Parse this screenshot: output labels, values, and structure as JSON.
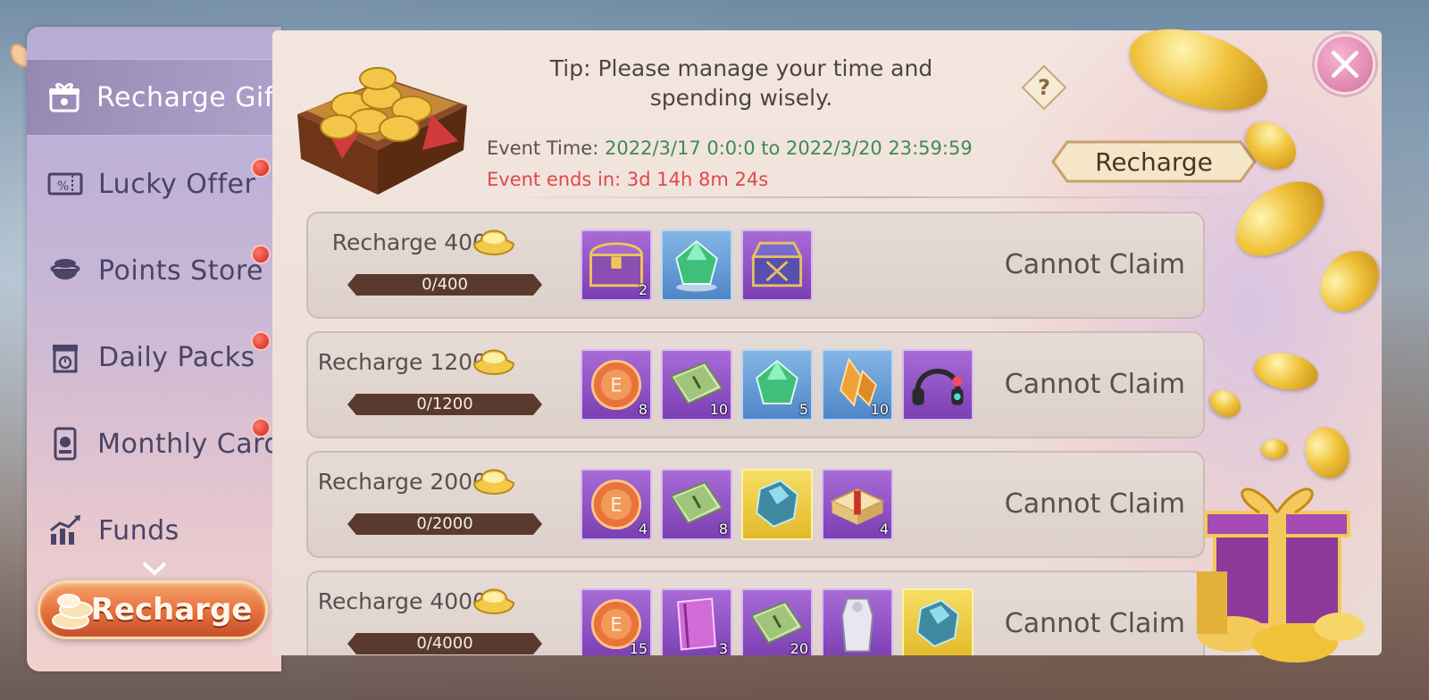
{
  "sidebar": {
    "items": [
      {
        "label": "Recharge Gift",
        "icon": "gift-box-icon",
        "active": true,
        "badge": false
      },
      {
        "label": "Lucky Offer",
        "icon": "discount-ticket-icon",
        "active": false,
        "badge": true
      },
      {
        "label": "Points Store",
        "icon": "coin-pot-icon",
        "active": false,
        "badge": true
      },
      {
        "label": "Daily Packs",
        "icon": "daily-box-icon",
        "active": false,
        "badge": true
      },
      {
        "label": "Monthly Card",
        "icon": "card-icon",
        "active": false,
        "badge": true
      },
      {
        "label": "Funds",
        "icon": "chart-up-icon",
        "active": false,
        "badge": false
      }
    ],
    "recharge_label": "Recharge"
  },
  "header": {
    "tip": "Tip: Please manage your time and spending wisely.",
    "event_time_label": "Event Time:",
    "event_time_value": "2022/3/17 0:0:0 to 2022/3/20 23:59:59",
    "event_ends": "Event ends in: 3d 14h 8m 24s",
    "recharge_label": "Recharge",
    "help_symbol": "?"
  },
  "tiers": [
    {
      "title": "Recharge 400",
      "progress": "0/400",
      "progress_fraction": 0,
      "status": "Cannot Claim",
      "items": [
        {
          "icon": "treasure-chest-icon",
          "rarity": "purple",
          "qty": "2"
        },
        {
          "icon": "green-gem-icon",
          "rarity": "blue",
          "qty": ""
        },
        {
          "icon": "ornate-chest-icon",
          "rarity": "purple",
          "qty": ""
        }
      ]
    },
    {
      "title": "Recharge 1200",
      "progress": "0/1200",
      "progress_fraction": 0,
      "status": "Cannot Claim",
      "items": [
        {
          "icon": "exp-orb-icon",
          "rarity": "purple",
          "qty": "8"
        },
        {
          "icon": "skill-book-icon",
          "rarity": "purple",
          "qty": "10"
        },
        {
          "icon": "green-gem-icon",
          "rarity": "blue",
          "qty": "5"
        },
        {
          "icon": "amber-crystal-icon",
          "rarity": "blue",
          "qty": "10"
        },
        {
          "icon": "headphones-icon",
          "rarity": "purple",
          "qty": ""
        }
      ]
    },
    {
      "title": "Recharge 2000",
      "progress": "0/2000",
      "progress_fraction": 0,
      "status": "Cannot Claim",
      "items": [
        {
          "icon": "exp-orb-icon",
          "rarity": "purple",
          "qty": "4"
        },
        {
          "icon": "skill-book-icon",
          "rarity": "purple",
          "qty": "8"
        },
        {
          "icon": "blue-ore-icon",
          "rarity": "gold",
          "qty": ""
        },
        {
          "icon": "gift-pack-icon",
          "rarity": "purple",
          "qty": "4"
        }
      ]
    },
    {
      "title": "Recharge 4000",
      "progress": "0/4000",
      "progress_fraction": 0,
      "status": "Cannot Claim",
      "items": [
        {
          "icon": "exp-orb-icon",
          "rarity": "purple",
          "qty": "15"
        },
        {
          "icon": "purple-book-icon",
          "rarity": "purple",
          "qty": "3"
        },
        {
          "icon": "skill-book-icon",
          "rarity": "purple",
          "qty": "20"
        },
        {
          "icon": "armor-outfit-icon",
          "rarity": "purple",
          "qty": ""
        },
        {
          "icon": "blue-ore-icon",
          "rarity": "gold",
          "qty": ""
        }
      ]
    }
  ],
  "colors": {
    "event_time_value": "#3f8a52",
    "event_ends": "#e2474a",
    "badge": "#d0231b",
    "rarity_purple": "#8e4fc4",
    "rarity_blue": "#5f96d2",
    "rarity_gold": "#ecc63b"
  }
}
